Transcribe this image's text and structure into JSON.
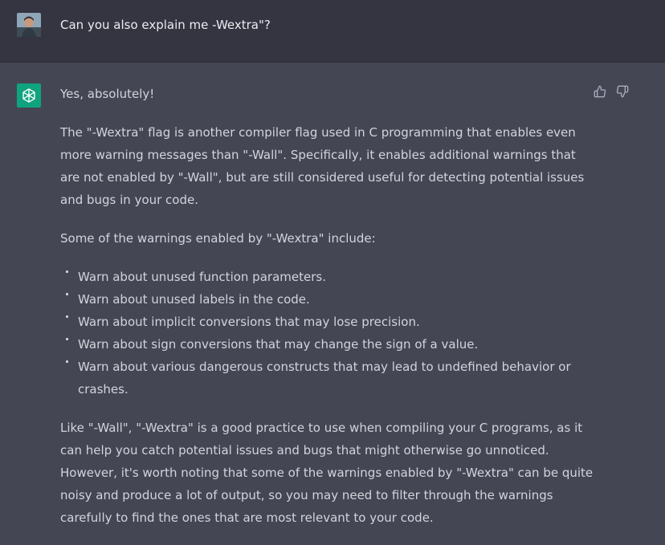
{
  "user_message": {
    "avatar_icon": "user-photo-icon",
    "text": "Can you also explain me -Wextra\"?"
  },
  "assistant_message": {
    "avatar_icon": "openai-logo-icon",
    "accent_color": "#10a37f",
    "paragraphs": [
      "Yes, absolutely!",
      "The \"-Wextra\" flag is another compiler flag used in C programming that enables even more warning messages than \"-Wall\". Specifically, it enables additional warnings that are not enabled by \"-Wall\", but are still considered useful for detecting potential issues and bugs in your code.",
      "Some of the warnings enabled by \"-Wextra\" include:"
    ],
    "bullets": [
      "Warn about unused function parameters.",
      "Warn about unused labels in the code.",
      "Warn about implicit conversions that may lose precision.",
      "Warn about sign conversions that may change the sign of a value.",
      "Warn about various dangerous constructs that may lead to undefined behavior or crashes."
    ],
    "closing": "Like \"-Wall\", \"-Wextra\" is a good practice to use when compiling your C programs, as it can help you catch potential issues and bugs that might otherwise go unnoticed. However, it's worth noting that some of the warnings enabled by \"-Wextra\" can be quite noisy and produce a lot of output, so you may need to filter through the warnings carefully to find the ones that are most relevant to your code."
  },
  "feedback": {
    "thumbs_up_icon": "thumbs-up-icon",
    "thumbs_down_icon": "thumbs-down-icon"
  }
}
